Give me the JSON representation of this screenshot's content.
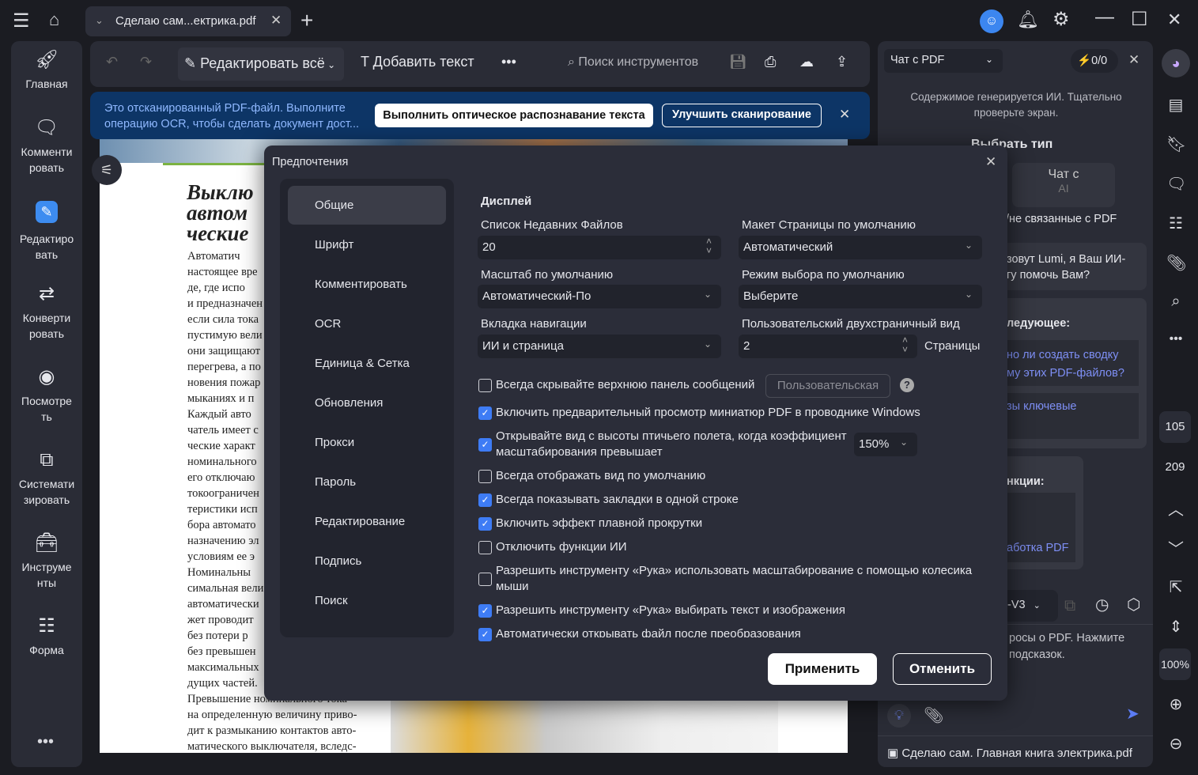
{
  "titlebar": {
    "tab_title": "Сделаю сам...ектрика.pdf"
  },
  "sidebar": {
    "items": [
      {
        "label": "Главная",
        "icon": "rocket-icon"
      },
      {
        "label": "Комменти ровать",
        "icon": "comment-icon"
      },
      {
        "label": "Редактиро вать",
        "icon": "edit-icon"
      },
      {
        "label": "Конверти ровать",
        "icon": "convert-icon"
      },
      {
        "label": "Посмотре ть",
        "icon": "eye-icon"
      },
      {
        "label": "Системати зировать",
        "icon": "organize-icon"
      },
      {
        "label": "Инструме нты",
        "icon": "toolbox-icon"
      },
      {
        "label": "Форма",
        "icon": "form-icon"
      }
    ]
  },
  "toolbar": {
    "edit_all": "Редактировать всё",
    "add_text": "Добавить текст",
    "search_placeholder": "Поиск инструментов"
  },
  "banner": {
    "text": "Это отсканированный PDF-файл. Выполните операцию OCR, чтобы сделать документ дост...",
    "ocr_button": "Выполнить оптическое распознавание текста",
    "enhance_button": "Улучшить сканирование"
  },
  "pdf": {
    "heading": "Выклю автом ческие",
    "lines": [
      "Автоматич",
      "настоящее вре",
      "де, где испо",
      "и предназначен",
      "если сила тока",
      "пустимую вели",
      "они защищают",
      "перегрева, а по",
      "новения пожар",
      "мыканиях и п",
      "Каждый авто",
      "чатель имеет с",
      "ческие характ",
      "номинального",
      "его отключаю",
      "токоограничен",
      "теристики исп",
      "бора автомато",
      "назначению эл",
      "условиям ее э",
      "Номинальны",
      "симальная вели",
      "автоматически",
      "жет проводит",
      "без потери р",
      "без превышен",
      "максимальных",
      "дущих частей.",
      "Превышение номинального тока",
      "на определенную величину приво-",
      "дит к размыканию контактов авто-",
      "матического выключателя, вследс-"
    ]
  },
  "dialog": {
    "title": "Предпочтения",
    "nav": [
      "Общие",
      "Шрифт",
      "Комментировать",
      "OCR",
      "Единица & Сетка",
      "Обновления",
      "Прокси",
      "Пароль",
      "Редактирование",
      "Подпись",
      "Поиск"
    ],
    "section": "Дисплей",
    "recent_label": "Список Недавних Файлов",
    "recent_value": "20",
    "layout_label": "Макет Страницы по умолчанию",
    "layout_value": "Автоматический",
    "zoom_label": "Масштаб по умолчанию",
    "zoom_value": "Автоматический-По",
    "select_label": "Режим выбора по умолчанию",
    "select_value": "Выберите",
    "navtab_label": "Вкладка навигации",
    "navtab_value": "ИИ и страница",
    "twopage_label": "Пользовательский двухстраничный вид",
    "twopage_value": "2",
    "twopage_unit": "Страницы",
    "custom_button": "Пользовательская",
    "birdseye_value": "150%",
    "options": [
      {
        "label": "Всегда скрывайте верхнюю панель сообщений",
        "checked": false
      },
      {
        "label": "Включить предварительный просмотр миниатюр PDF в проводнике Windows",
        "checked": true
      },
      {
        "label": "Открывайте вид с высоты птичьего полета, когда коэффициент масштабирования превышает",
        "checked": true
      },
      {
        "label": "Всегда отображать вид по умолчанию",
        "checked": false
      },
      {
        "label": "Всегда показывать закладки в одной строке",
        "checked": true
      },
      {
        "label": "Включить эффект плавной прокрутки",
        "checked": true
      },
      {
        "label": "Отключить функции ИИ",
        "checked": false
      },
      {
        "label": "Разрешить инструменту «Рука» использовать масштабирование с помощью колесика мыши",
        "checked": false
      },
      {
        "label": "Разрешить инструменту «Рука» выбирать текст и изображения",
        "checked": true
      },
      {
        "label": "Автоматически открывать файл после преобразования",
        "checked": true
      }
    ],
    "apply": "Применить",
    "cancel": "Отменить"
  },
  "chat": {
    "mode": "Чат с PDF",
    "credits": "0/0",
    "disclaimer": "Содержимое генерируется ИИ. Тщательно проверьте экран.",
    "choose_type": "Выбрать тип",
    "chat_ai_1": "Чат с",
    "chat_ai_2": "AI",
    "unrelated": "/не связанные с PDF",
    "greeting": "зовут Lumi, я Ваш ИИ- гу помочь Вам?",
    "following": "ледующее:",
    "s1": "но ли создать сводку му этих PDF-файлов?",
    "s2": "зы ключевые",
    "functions": "нкции:",
    "f1": "аботка PDF",
    "model": "-V3",
    "input_hint": "росы о PDF. Нажмите подсказок.",
    "file": "Сделаю сам. Главная книга электрика.pdf"
  },
  "rail": {
    "page_current": "105",
    "page_total": "209",
    "zoom": "100%"
  },
  "colors": {
    "accent": "#3e7cf5",
    "banner": "#0d3566",
    "link": "#7e8ff5"
  }
}
